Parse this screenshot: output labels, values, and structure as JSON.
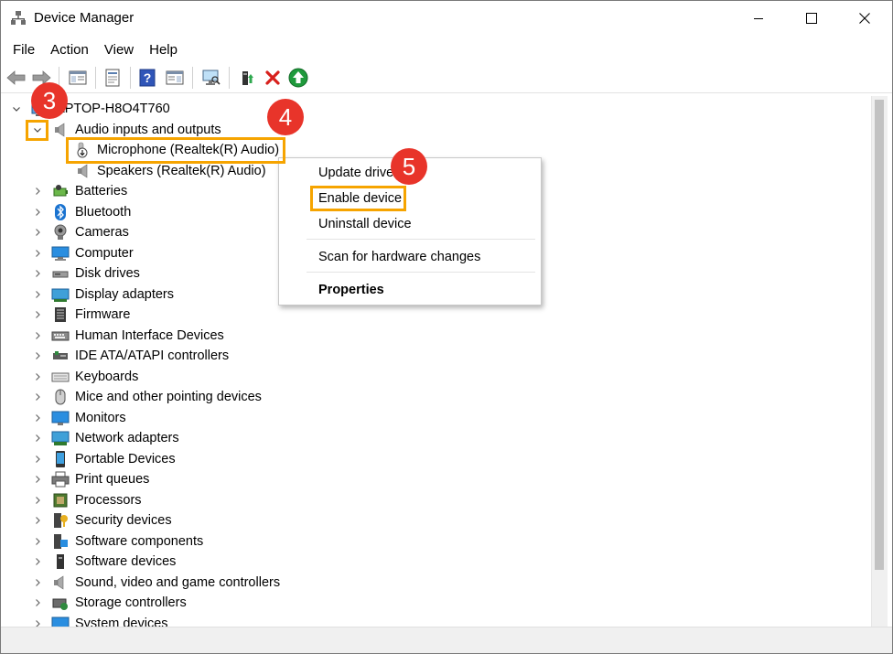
{
  "window": {
    "title": "Device Manager"
  },
  "menu": [
    "File",
    "Action",
    "View",
    "Help"
  ],
  "tree": {
    "root": "LAPTOP-H8O4T760",
    "audio_group": "Audio inputs and outputs",
    "audio_children": [
      "Microphone (Realtek(R) Audio)",
      "Speakers (Realtek(R) Audio)"
    ],
    "categories": [
      {
        "label": "Batteries",
        "icon": "battery-icon"
      },
      {
        "label": "Bluetooth",
        "icon": "bluetooth-icon"
      },
      {
        "label": "Cameras",
        "icon": "camera-icon"
      },
      {
        "label": "Computer",
        "icon": "computer-icon"
      },
      {
        "label": "Disk drives",
        "icon": "disk-drive-icon"
      },
      {
        "label": "Display adapters",
        "icon": "display-adapter-icon"
      },
      {
        "label": "Firmware",
        "icon": "firmware-icon"
      },
      {
        "label": "Human Interface Devices",
        "icon": "hid-icon"
      },
      {
        "label": "IDE ATA/ATAPI controllers",
        "icon": "ide-controller-icon"
      },
      {
        "label": "Keyboards",
        "icon": "keyboard-icon"
      },
      {
        "label": "Mice and other pointing devices",
        "icon": "mouse-icon"
      },
      {
        "label": "Monitors",
        "icon": "monitor-icon"
      },
      {
        "label": "Network adapters",
        "icon": "network-adapter-icon"
      },
      {
        "label": "Portable Devices",
        "icon": "portable-device-icon"
      },
      {
        "label": "Print queues",
        "icon": "printer-icon"
      },
      {
        "label": "Processors",
        "icon": "processor-icon"
      },
      {
        "label": "Security devices",
        "icon": "security-device-icon"
      },
      {
        "label": "Software components",
        "icon": "software-component-icon"
      },
      {
        "label": "Software devices",
        "icon": "software-device-icon"
      },
      {
        "label": "Sound, video and game controllers",
        "icon": "sound-icon"
      },
      {
        "label": "Storage controllers",
        "icon": "storage-controller-icon"
      },
      {
        "label": "System devices",
        "icon": "system-device-icon"
      }
    ]
  },
  "context_menu": {
    "update_driver": "Update driver",
    "enable_device": "Enable device",
    "uninstall_device": "Uninstall device",
    "scan": "Scan for hardware changes",
    "properties": "Properties"
  },
  "annotations": {
    "step3": "3",
    "step4": "4",
    "step5": "5"
  },
  "colors": {
    "highlight": "#f6a400",
    "badge": "#e8342a",
    "accent": "#0078d7"
  }
}
